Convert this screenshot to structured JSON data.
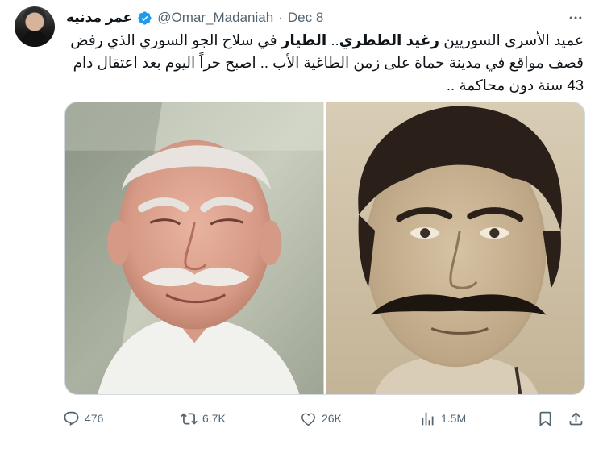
{
  "author": {
    "display_name": "عمر مدنيه",
    "handle": "@Omar_Madaniah",
    "separator": "·",
    "date": "Dec 8",
    "verified": true
  },
  "tweet": {
    "text_part1": "عميد الأسرى السوريين ",
    "text_bold1": "رغيد الططري",
    "text_part2": ".. ",
    "text_bold2": "الطيار",
    "text_part3": " في سلاح الجو السوري الذي رفض قصف مواقع في مدينة حماة على زمن الطاغية الأب .. اصبح حراً اليوم بعد اعتقال دام 43 سنة دون محاكمة .."
  },
  "media": {
    "left_photo": "elderly-man-photo",
    "right_photo": "young-man-archive-photo"
  },
  "actions": {
    "reply_count": "476",
    "retweet_count": "6.7K",
    "like_count": "26K",
    "views_count": "1.5M"
  },
  "icons": {
    "verified": "verified-badge-icon",
    "more": "more-icon",
    "reply": "reply-icon",
    "retweet": "retweet-icon",
    "like": "heart-icon",
    "views": "views-icon",
    "bookmark": "bookmark-icon",
    "share": "share-icon"
  },
  "colors": {
    "verified": "#1d9bf0",
    "muted": "#536471",
    "text": "#0f1419"
  }
}
